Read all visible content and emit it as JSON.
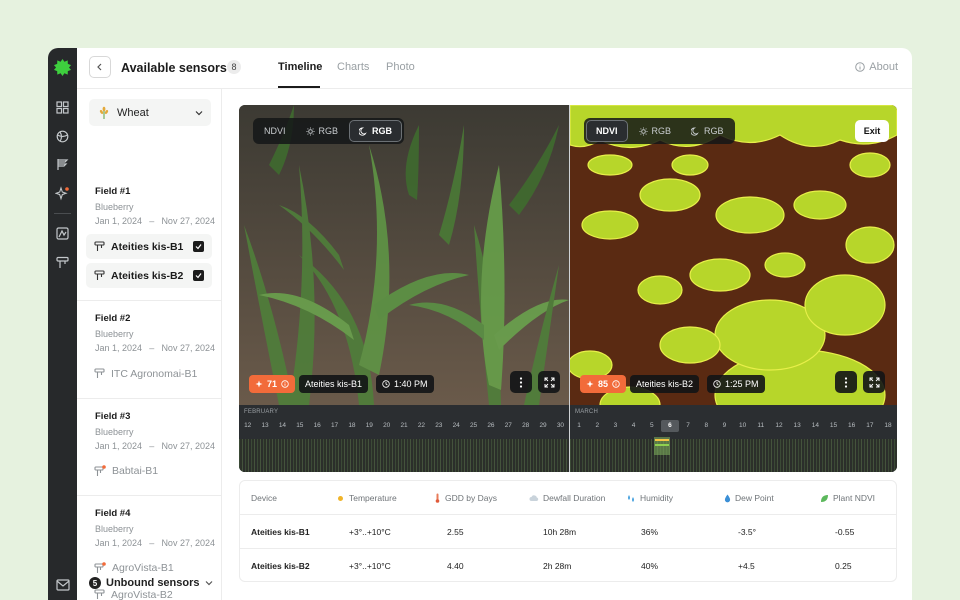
{
  "header": {
    "back_label": "Back",
    "title": "Available sensors",
    "count": "8",
    "tabs": [
      "Timeline",
      "Charts",
      "Photo"
    ],
    "active_tab": "Timeline",
    "about": "About"
  },
  "sidebar": {
    "crop": "Wheat",
    "fields": [
      {
        "title": "Field #1",
        "crop": "Blueberry",
        "start": "Jan 1, 2024",
        "end": "Nov 27, 2024",
        "sensors": [
          {
            "name": "Ateities kis-B1",
            "checked": true
          },
          {
            "name": "Ateities kis-B2",
            "checked": true
          }
        ]
      },
      {
        "title": "Field #2",
        "crop": "Blueberry",
        "start": "Jan 1, 2024",
        "end": "Nov 27, 2024",
        "sensors": [
          {
            "name": "ITC Agronomai-B1"
          }
        ]
      },
      {
        "title": "Field #3",
        "crop": "Blueberry",
        "start": "Jan 1, 2024",
        "end": "Nov 27, 2024",
        "sensors": [
          {
            "name": "Babtai-B1"
          }
        ]
      },
      {
        "title": "Field #4",
        "crop": "Blueberry",
        "start": "Jan 1, 2024",
        "end": "Nov 27, 2024",
        "sensors": [
          {
            "name": "AgroVista-B1"
          },
          {
            "name": "AgroVista-B2"
          }
        ]
      }
    ],
    "unbound": {
      "count": "5",
      "label": "Unbound sensors"
    }
  },
  "viewer": {
    "left": {
      "modes": [
        "NDVI",
        "RGB",
        "RGB"
      ],
      "active_mode": 2,
      "score": "71",
      "sensor": "Ateities kis-B1",
      "time": "1:40 PM"
    },
    "right": {
      "modes": [
        "NDVI",
        "RGB",
        "RGB"
      ],
      "active_mode": 0,
      "score": "85",
      "sensor": "Ateities kis-B2",
      "time": "1:25 PM",
      "exit": "Exit"
    },
    "timeline": {
      "left_month": "FEBRUARY",
      "left_days": [
        "12",
        "13",
        "14",
        "15",
        "16",
        "17",
        "18",
        "19",
        "20",
        "21",
        "22",
        "23",
        "24",
        "25",
        "26",
        "27",
        "28",
        "29",
        "30"
      ],
      "right_month": "MARCH",
      "right_days": [
        "1",
        "2",
        "3",
        "4",
        "5",
        "6",
        "7",
        "8",
        "9",
        "10",
        "11",
        "12",
        "13",
        "14",
        "15",
        "16",
        "17",
        "18"
      ],
      "current_day": "6"
    }
  },
  "table": {
    "headers": [
      "Device",
      "Temperature",
      "GDD by Days",
      "Dewfall Duration",
      "Humidity",
      "Dew Point",
      "Plant NDVI"
    ],
    "rows": [
      [
        "Ateities kis-B1",
        "+3°..+10°C",
        "2.55",
        "10h 28m",
        "36%",
        "-3.5°",
        "-0.55"
      ],
      [
        "Ateities kis-B2",
        "+3°..+10°C",
        "4.40",
        "2h 28m",
        "40%",
        "+4.5",
        "0.25"
      ]
    ]
  },
  "colors": {
    "brand": "#3ecf3e",
    "accent_orange": "#f26b3a",
    "rail": "#27292b"
  }
}
